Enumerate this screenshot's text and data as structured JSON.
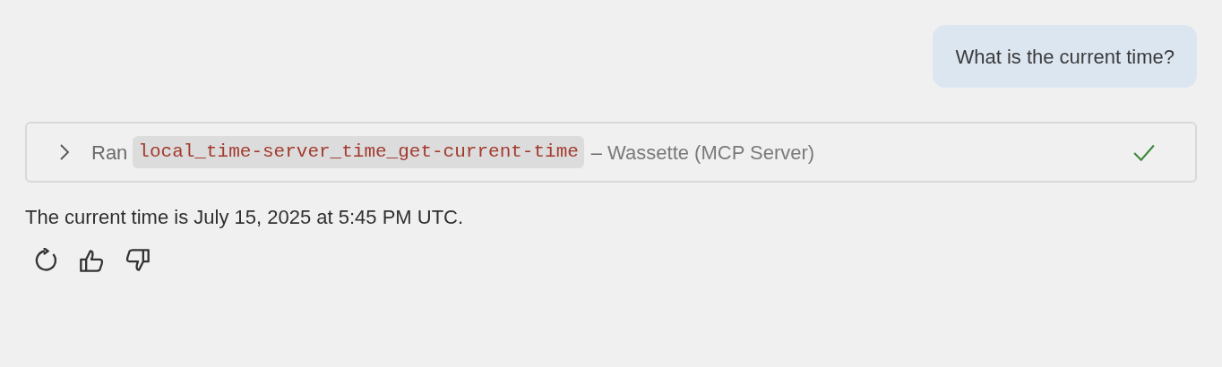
{
  "user_message": "What is the current time?",
  "tool_call": {
    "expanded": false,
    "verb": "Ran",
    "tool_name": "local_time-server_time_get-current-time",
    "separator": "–",
    "source": "Wassette (MCP Server)",
    "succeeded": true
  },
  "response": "The current time is July 15, 2025 at 5:45 PM UTC.",
  "actions": [
    {
      "kind": "retry"
    },
    {
      "kind": "thumbs_up"
    },
    {
      "kind": "thumbs_down"
    }
  ]
}
